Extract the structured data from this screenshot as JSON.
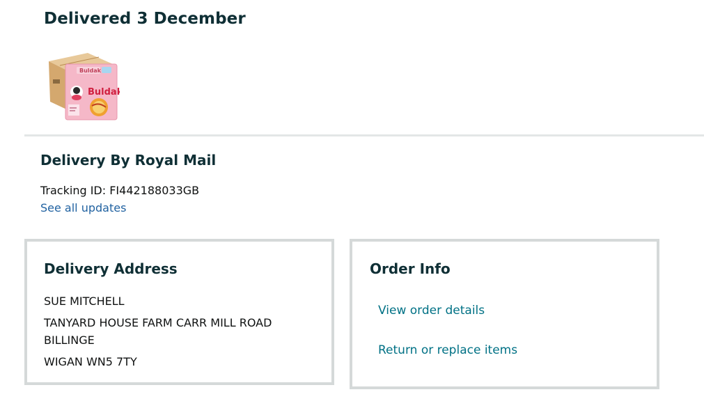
{
  "delivery": {
    "status": "Delivered 3 December",
    "product_image_icon": "noodle-multipack-product-image"
  },
  "shipment": {
    "carrier_heading": "Delivery By Royal Mail",
    "tracking_id": "Tracking ID: FI442188033GB",
    "see_all_updates": "See all updates"
  },
  "address": {
    "title": "Delivery Address",
    "name": "SUE MITCHELL",
    "street": "TANYARD HOUSE FARM CARR MILL ROAD",
    "locality": "BILLINGE",
    "town_postcode": "WIGAN WN5 7TY"
  },
  "order_info": {
    "title": "Order Info",
    "view_order_details": "View order details",
    "return_or_replace": "Return or replace items"
  },
  "colors": {
    "heading": "#0f2f35",
    "link_blue": "#2162a1",
    "link_teal": "#007185",
    "card_border": "#d5d9d9",
    "divider": "#e3e6e6"
  }
}
